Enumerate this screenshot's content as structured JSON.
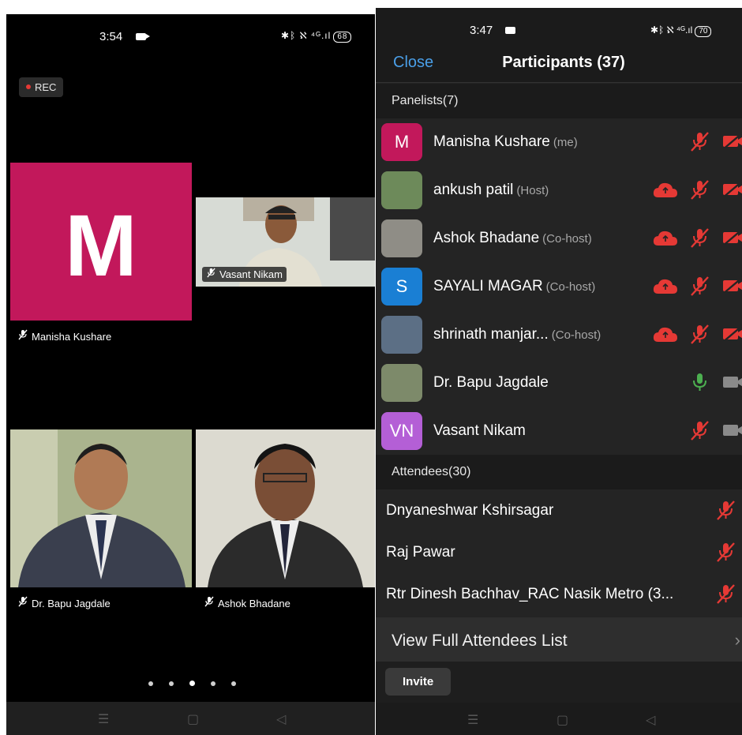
{
  "left_phone": {
    "status": {
      "time": "3:54",
      "signal": "✱ᛒ ℵ ⁴ᴳ.ıl",
      "battery": "68"
    },
    "rec_label": "REC",
    "tiles": {
      "manisha": {
        "initial": "M",
        "name": "Manisha Kushare"
      },
      "vasant": {
        "name": "Vasant Nikam"
      },
      "bapu": {
        "name": "Dr. Bapu Jagdale"
      },
      "ashok": {
        "name": "Ashok Bhadane"
      }
    },
    "page_dots": 5,
    "active_page": 3
  },
  "right_phone": {
    "status": {
      "time": "3:47",
      "signal": "✱ᛒ ℵ ⁴ᴳ.ıl",
      "battery": "70"
    },
    "close_label": "Close",
    "title": "Participants (37)",
    "panelists_header": "Panelists(7)",
    "panelists": [
      {
        "initials": "M",
        "name": "Manisha Kushare",
        "role": "(me)",
        "avatar_color": "#c2185b",
        "cloud": false,
        "mic": "muted",
        "video": "off"
      },
      {
        "initials": "",
        "name": "ankush patil",
        "role": "(Host)",
        "avatar_color": "#6d8a5a",
        "cloud": true,
        "mic": "muted",
        "video": "off"
      },
      {
        "initials": "",
        "name": "Ashok Bhadane",
        "role": "(Co-host)",
        "avatar_color": "#8f8d86",
        "cloud": true,
        "mic": "muted",
        "video": "off"
      },
      {
        "initials": "S",
        "name": "SAYALI MAGAR",
        "role": "(Co-host)",
        "avatar_color": "#1a7fd4",
        "cloud": true,
        "mic": "muted",
        "video": "off"
      },
      {
        "initials": "",
        "name": "shrinath manjar...",
        "role": "(Co-host)",
        "avatar_color": "#5c6f85",
        "cloud": true,
        "mic": "muted",
        "video": "off"
      },
      {
        "initials": "",
        "name": "Dr. Bapu Jagdale",
        "role": "",
        "avatar_color": "#7d8a6a",
        "cloud": false,
        "mic": "on",
        "video": "grey"
      },
      {
        "initials": "VN",
        "name": "Vasant Nikam",
        "role": "",
        "avatar_color": "#b45fd6",
        "cloud": false,
        "mic": "muted",
        "video": "grey"
      }
    ],
    "attendees_header": "Attendees(30)",
    "attendees": [
      {
        "name": "Dnyaneshwar Kshirsagar"
      },
      {
        "name": "Raj Pawar"
      },
      {
        "name": "Rtr Dinesh Bachhav_RAC Nasik Metro (3..."
      }
    ],
    "view_full_label": "View Full Attendees List",
    "invite_label": "Invite"
  },
  "colors": {
    "accent_blue": "#4a9fe8",
    "muted_red": "#e53935",
    "mic_green": "#4caf50"
  }
}
